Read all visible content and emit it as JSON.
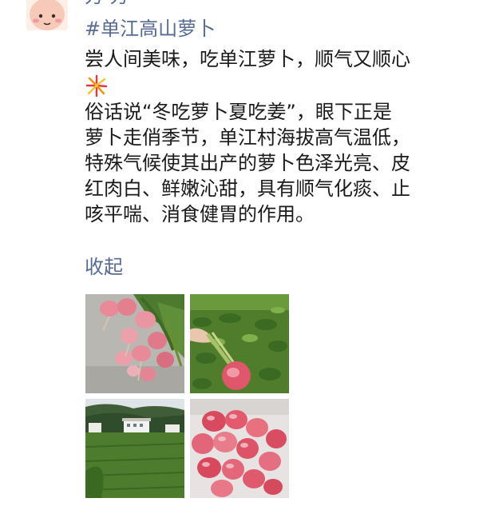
{
  "post": {
    "author": "芳·芳",
    "hashtag": "#单江高山萝卜",
    "lines": [
      "尝人间美味，吃单江萝卜，顺气又顺心",
      "俗话说“冬吃萝卜夏吃姜”，眼下正是",
      "萝卜走俏季节，单江村海拔高气温低，",
      "特殊气候使其出产的萝卜色泽光亮、皮",
      "红肉白、鲜嫩沁甜，具有顺气化痰、止",
      "咳平喘、消食健胃的作用。"
    ],
    "emoji": "fireworks-icon",
    "collapse_label": "收起"
  },
  "photos": [
    {
      "name": "radish-bunch-photo"
    },
    {
      "name": "radish-held-in-field-photo"
    },
    {
      "name": "village-field-photo"
    },
    {
      "name": "radishes-in-bag-photo"
    }
  ],
  "colors": {
    "link": "#576b95",
    "text": "#1a1a1a"
  }
}
